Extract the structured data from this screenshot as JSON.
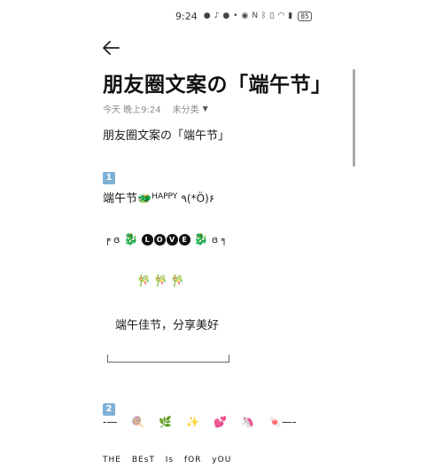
{
  "status_bar": {
    "time": "9:24",
    "battery": "85",
    "icons": [
      "wechat-icon",
      "tiktok-icon",
      "chat-icon",
      "dot-icon",
      "eye-icon",
      "nfc-icon",
      "bluetooth-icon",
      "vibrate-icon",
      "wifi-icon",
      "signal-icon"
    ]
  },
  "header": {
    "back_icon": "back-arrow-icon",
    "title": "朋友圈文案の「端午节」",
    "date": "今天 晚上9:24",
    "folder": "未分类"
  },
  "content": {
    "subtitle": "朋友圈文案の「端午节」",
    "section1": {
      "badge": "1",
      "line1_text": "端午节",
      "line1_happy": "HAPPY",
      "line1_kaomoji": "٩(*Ö)۶",
      "love_left": "╒ ɞ",
      "love_letters": [
        "L",
        "O",
        "V",
        "E"
      ],
      "love_right": "ɞ ╕",
      "bamboo": "🎋🎋🎋",
      "greeting": "端午佳节，分享美好"
    },
    "section2": {
      "badge": "2",
      "emoji_line": [
        "-—",
        "🍭",
        "🌿",
        "✨",
        "💕",
        "🦄",
        "🍬—-"
      ],
      "best_line": "THE BEsT Is fOR yOU"
    }
  }
}
